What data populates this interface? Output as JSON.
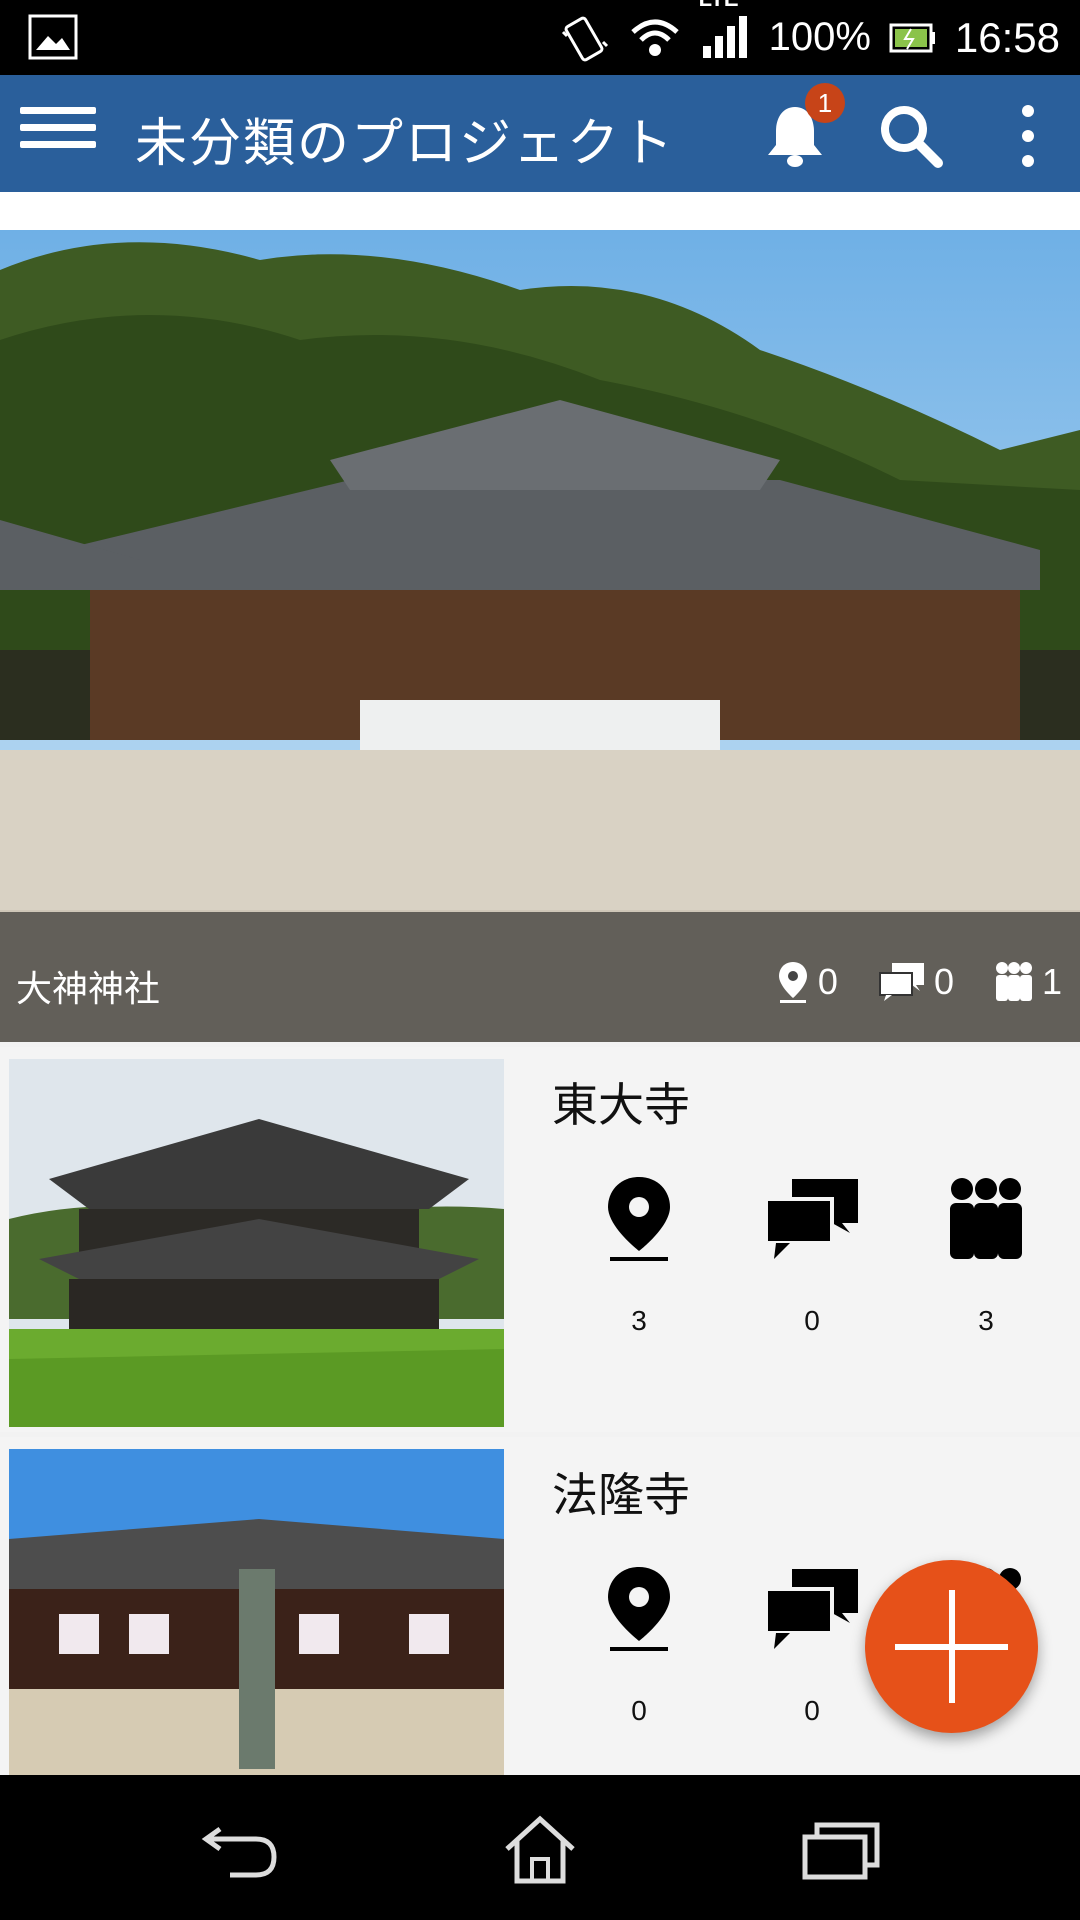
{
  "status_bar": {
    "network": "LTE",
    "battery": "100%",
    "time": "16:58",
    "icons": [
      "image-icon",
      "vibrate-icon",
      "wifi-icon",
      "signal-icon",
      "battery-icon"
    ]
  },
  "app_bar": {
    "title": "未分類のプロジェクト",
    "notification_count": "1",
    "icons": [
      "menu-icon",
      "bell-icon",
      "search-icon",
      "more-vert-icon"
    ]
  },
  "featured": {
    "name": "大神神社",
    "spots": "0",
    "comments": "0",
    "members": "1"
  },
  "projects": [
    {
      "name": "東大寺",
      "spots": "3",
      "comments": "0",
      "members": "3"
    },
    {
      "name": "法隆寺",
      "spots": "0",
      "comments": "0",
      "members": ""
    }
  ],
  "colors": {
    "app_bar": "#2a5f9b",
    "fab": "#e65119",
    "badge": "#c74418"
  }
}
